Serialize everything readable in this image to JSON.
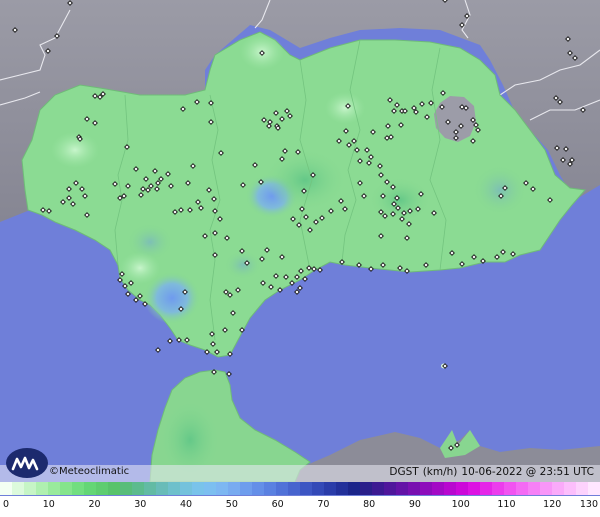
{
  "map": {
    "copyright": "©",
    "brand": "Meteoclimatic",
    "variable": "DGST",
    "unit": "(km/h)",
    "timestamp": "10-06-2022 @ 23:51 UTC"
  },
  "legend": {
    "ticks": [
      "0",
      "10",
      "20",
      "30",
      "40",
      "50",
      "60",
      "70",
      "80",
      "90",
      "100",
      "110",
      "120",
      "130"
    ],
    "colors": [
      "#f3fff3",
      "#dcfadc",
      "#c6f5c6",
      "#aff0b0",
      "#99ea9c",
      "#85e48c",
      "#72de80",
      "#64d676",
      "#5ecd70",
      "#58c36b",
      "#58bd7a",
      "#5cbb8e",
      "#62bba4",
      "#68bcb8",
      "#6ec0cb",
      "#74c2dc",
      "#79c3ea",
      "#7cbff0",
      "#7db7f2",
      "#78abf0",
      "#6e9ded",
      "#648fe8",
      "#5a81e1",
      "#5072d8",
      "#4764ce",
      "#3d56c3",
      "#3349b7",
      "#2a3ca9",
      "#22309a",
      "#1b258a",
      "#2a1f8a",
      "#3c1a92",
      "#4f169b",
      "#6312a6",
      "#780fb0",
      "#8e0cbb",
      "#a30ac5",
      "#b808cf",
      "#cc08d9",
      "#dc12e2",
      "#e526e8",
      "#ec3ced",
      "#f153f1",
      "#f46af4",
      "#f680f6",
      "#f896f8",
      "#faaafa",
      "#fcbefc",
      "#fdd2fd",
      "#ffe6ff"
    ],
    "colors_meta": "legend colors low→high"
  },
  "stations": [
    [
      70,
      3
    ],
    [
      15,
      30
    ],
    [
      57,
      36
    ],
    [
      48,
      51
    ],
    [
      95,
      96
    ],
    [
      103,
      94
    ],
    [
      100,
      97
    ],
    [
      79,
      137
    ],
    [
      87,
      119
    ],
    [
      95,
      123
    ],
    [
      80,
      139
    ],
    [
      211,
      122
    ],
    [
      183,
      109
    ],
    [
      197,
      102
    ],
    [
      211,
      103
    ],
    [
      262,
      53
    ],
    [
      282,
      119
    ],
    [
      270,
      122
    ],
    [
      277,
      126
    ],
    [
      276,
      113
    ],
    [
      287,
      111
    ],
    [
      290,
      116
    ],
    [
      278,
      128
    ],
    [
      269,
      126
    ],
    [
      264,
      120
    ],
    [
      127,
      147
    ],
    [
      136,
      169
    ],
    [
      155,
      171
    ],
    [
      161,
      179
    ],
    [
      158,
      183
    ],
    [
      157,
      189
    ],
    [
      148,
      190
    ],
    [
      151,
      186
    ],
    [
      143,
      189
    ],
    [
      146,
      179
    ],
    [
      141,
      195
    ],
    [
      128,
      186
    ],
    [
      115,
      184
    ],
    [
      120,
      198
    ],
    [
      124,
      196
    ],
    [
      76,
      183
    ],
    [
      69,
      198
    ],
    [
      73,
      204
    ],
    [
      82,
      189
    ],
    [
      85,
      196
    ],
    [
      63,
      202
    ],
    [
      69,
      189
    ],
    [
      43,
      210
    ],
    [
      49,
      211
    ],
    [
      87,
      215
    ],
    [
      168,
      174
    ],
    [
      171,
      186
    ],
    [
      188,
      183
    ],
    [
      175,
      212
    ],
    [
      181,
      210
    ],
    [
      190,
      210
    ],
    [
      198,
      202
    ],
    [
      201,
      208
    ],
    [
      209,
      190
    ],
    [
      214,
      199
    ],
    [
      215,
      211
    ],
    [
      220,
      219
    ],
    [
      243,
      185
    ],
    [
      221,
      153
    ],
    [
      193,
      166
    ],
    [
      261,
      182
    ],
    [
      255,
      165
    ],
    [
      282,
      159
    ],
    [
      285,
      151
    ],
    [
      298,
      152
    ],
    [
      313,
      175
    ],
    [
      304,
      191
    ],
    [
      302,
      209
    ],
    [
      306,
      217
    ],
    [
      293,
      219
    ],
    [
      299,
      225
    ],
    [
      310,
      230
    ],
    [
      316,
      222
    ],
    [
      322,
      218
    ],
    [
      339,
      141
    ],
    [
      348,
      106
    ],
    [
      346,
      131
    ],
    [
      354,
      141
    ],
    [
      349,
      145
    ],
    [
      357,
      150
    ],
    [
      360,
      161
    ],
    [
      367,
      150
    ],
    [
      371,
      157
    ],
    [
      369,
      163
    ],
    [
      373,
      132
    ],
    [
      388,
      126
    ],
    [
      387,
      138
    ],
    [
      391,
      137
    ],
    [
      390,
      100
    ],
    [
      394,
      111
    ],
    [
      397,
      105
    ],
    [
      402,
      111
    ],
    [
      405,
      111
    ],
    [
      401,
      125
    ],
    [
      414,
      108
    ],
    [
      416,
      112
    ],
    [
      422,
      104
    ],
    [
      427,
      117
    ],
    [
      431,
      103
    ],
    [
      443,
      93
    ],
    [
      442,
      107
    ],
    [
      448,
      122
    ],
    [
      462,
      107
    ],
    [
      466,
      108
    ],
    [
      461,
      126
    ],
    [
      456,
      132
    ],
    [
      456,
      138
    ],
    [
      473,
      120
    ],
    [
      476,
      125
    ],
    [
      478,
      130
    ],
    [
      473,
      141
    ],
    [
      380,
      166
    ],
    [
      381,
      175
    ],
    [
      387,
      182
    ],
    [
      393,
      187
    ],
    [
      397,
      198
    ],
    [
      394,
      204
    ],
    [
      383,
      196
    ],
    [
      381,
      212
    ],
    [
      385,
      216
    ],
    [
      393,
      214
    ],
    [
      398,
      208
    ],
    [
      404,
      213
    ],
    [
      402,
      219
    ],
    [
      409,
      224
    ],
    [
      410,
      211
    ],
    [
      421,
      194
    ],
    [
      418,
      209
    ],
    [
      434,
      213
    ],
    [
      360,
      183
    ],
    [
      364,
      196
    ],
    [
      341,
      201
    ],
    [
      345,
      209
    ],
    [
      331,
      211
    ],
    [
      381,
      236
    ],
    [
      407,
      238
    ],
    [
      342,
      262
    ],
    [
      359,
      265
    ],
    [
      371,
      269
    ],
    [
      383,
      265
    ],
    [
      400,
      268
    ],
    [
      407,
      271
    ],
    [
      426,
      265
    ],
    [
      452,
      253
    ],
    [
      462,
      264
    ],
    [
      474,
      257
    ],
    [
      483,
      261
    ],
    [
      497,
      257
    ],
    [
      503,
      252
    ],
    [
      513,
      254
    ],
    [
      501,
      196
    ],
    [
      505,
      188
    ],
    [
      526,
      183
    ],
    [
      533,
      189
    ],
    [
      550,
      200
    ],
    [
      557,
      148
    ],
    [
      566,
      149
    ],
    [
      563,
      160
    ],
    [
      572,
      160
    ],
    [
      570,
      164
    ],
    [
      568,
      39
    ],
    [
      570,
      53
    ],
    [
      575,
      58
    ],
    [
      583,
      110
    ],
    [
      560,
      102
    ],
    [
      556,
      98
    ],
    [
      467,
      16
    ],
    [
      445,
      0
    ],
    [
      462,
      25
    ],
    [
      215,
      233
    ],
    [
      227,
      238
    ],
    [
      215,
      255
    ],
    [
      205,
      236
    ],
    [
      242,
      251
    ],
    [
      247,
      263
    ],
    [
      262,
      259
    ],
    [
      267,
      250
    ],
    [
      282,
      257
    ],
    [
      276,
      276
    ],
    [
      263,
      283
    ],
    [
      271,
      287
    ],
    [
      280,
      290
    ],
    [
      292,
      283
    ],
    [
      297,
      277
    ],
    [
      301,
      271
    ],
    [
      309,
      268
    ],
    [
      314,
      269
    ],
    [
      320,
      270
    ],
    [
      300,
      288
    ],
    [
      305,
      279
    ],
    [
      286,
      277
    ],
    [
      297,
      292
    ],
    [
      230,
      295
    ],
    [
      238,
      290
    ],
    [
      226,
      292
    ],
    [
      233,
      313
    ],
    [
      242,
      330
    ],
    [
      230,
      354
    ],
    [
      217,
      352
    ],
    [
      207,
      352
    ],
    [
      213,
      344
    ],
    [
      225,
      330
    ],
    [
      212,
      334
    ],
    [
      145,
      304
    ],
    [
      136,
      300
    ],
    [
      125,
      286
    ],
    [
      120,
      280
    ],
    [
      122,
      274
    ],
    [
      131,
      283
    ],
    [
      128,
      294
    ],
    [
      140,
      296
    ],
    [
      179,
      340
    ],
    [
      158,
      350
    ],
    [
      170,
      341
    ],
    [
      181,
      309
    ],
    [
      185,
      292
    ],
    [
      187,
      340
    ],
    [
      214,
      372
    ],
    [
      229,
      374
    ],
    [
      445,
      366
    ],
    [
      451,
      448
    ],
    [
      457,
      445
    ]
  ]
}
